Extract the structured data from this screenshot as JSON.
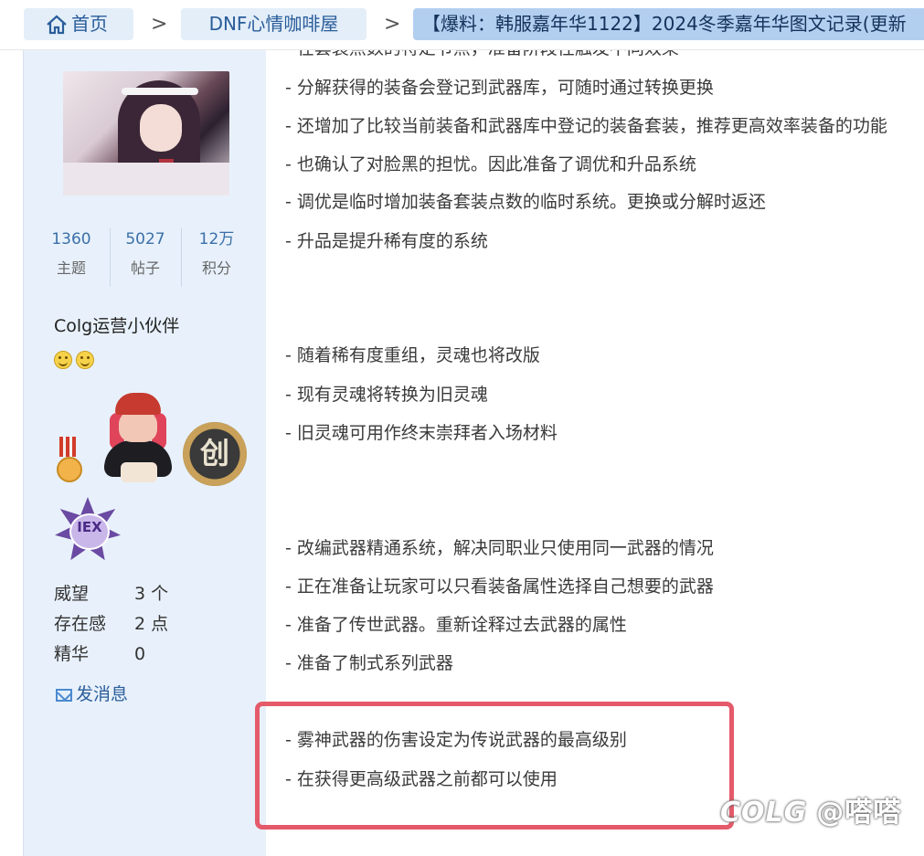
{
  "breadcrumb": {
    "home_label": "首页",
    "forum_label": "DNF心情咖啡屋",
    "thread_label": "【爆料：韩服嘉年华1122】2024冬季嘉年华图文记录(更新"
  },
  "profile": {
    "stats": [
      {
        "value": "1360",
        "label": "主题"
      },
      {
        "value": "5027",
        "label": "帖子"
      },
      {
        "value": "12万",
        "label": "积分"
      }
    ],
    "username": "Colg运营小伙伴",
    "medal_chuang_text": "创",
    "medal_iex_text": "IEX",
    "info": [
      {
        "key": "威望",
        "value": "3 个"
      },
      {
        "key": "存在感",
        "value": "2 点"
      },
      {
        "key": "精华",
        "value": "0"
      }
    ],
    "send_message_label": "发消息"
  },
  "post": {
    "lines": [
      "- 在套装点数的特定节点，准备阶段性触发不同效果",
      "- 分解获得的装备会登记到武器库，可随时通过转换更换",
      "- 还增加了比较当前装备和武器库中登记的装备套装，推荐更高效率装备的功能",
      "- 也确认了对脸黑的担忧。因此准备了调优和升品系统",
      "- 调优是临时增加装备套装点数的临时系统。更换或分解时返还",
      "- 升品是提升稀有度的系统",
      "- 随着稀有度重组，灵魂也将改版",
      "- 现有灵魂将转换为旧灵魂",
      "- 旧灵魂可用作终末崇拜者入场材料",
      "- 改编武器精通系统，解决同职业只使用同一武器的情况",
      "- 正在准备让玩家可以只看装备属性选择自己想要的武器",
      "- 准备了传世武器。重新诠释过去武器的属性",
      "- 准备了制式系列武器",
      "- 雾神武器的伤害设定为传说武器的最高级别",
      "- 在获得更高级武器之前都可以使用"
    ]
  },
  "watermark": {
    "logo": "COLG",
    "handle": "@嗒嗒"
  },
  "colors": {
    "sidebar_bg": "#e8f1fb",
    "link_blue": "#2a5d9a",
    "highlight_border": "#e55a6a"
  }
}
